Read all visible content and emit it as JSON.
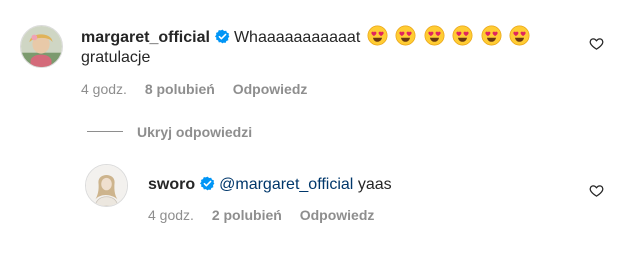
{
  "comments": [
    {
      "username": "margaret_official",
      "verified": true,
      "text_line1": "Whaaaaaaaaaaat",
      "emojis": [
        "heart-eyes",
        "heart-eyes",
        "heart-eyes",
        "heart-eyes",
        "heart-eyes",
        "heart-eyes"
      ],
      "text_line2": "gratulacje",
      "time": "4 godz.",
      "likes": "8 polubień",
      "reply": "Odpowiedz"
    },
    {
      "username": "sworo",
      "verified": true,
      "mention": "@margaret_official",
      "text": "yaas",
      "time": "4 godz.",
      "likes": "2 polubień",
      "reply": "Odpowiedz"
    }
  ],
  "replies_toggle": "Ukryj odpowiedzi",
  "colors": {
    "text": "#262626",
    "secondary": "#8e8e8e",
    "mention": "#00376b",
    "verified": "#0095f6"
  }
}
